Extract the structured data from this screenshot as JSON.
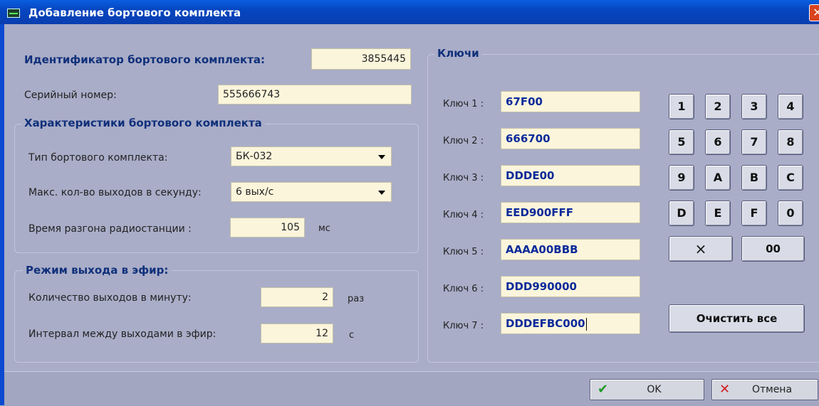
{
  "window": {
    "title": "Добавление бортового комплекта",
    "close_icon": "close-icon"
  },
  "left": {
    "identifier_label": "Идентификатор бортового комплекта:",
    "identifier_value": "3855445",
    "serial_label": "Серийный номер:",
    "serial_value": "555666743",
    "characteristics": {
      "title": "Характеристики бортового комплекта",
      "type_label": "Тип бортового комплекта:",
      "type_value": "БК-032",
      "max_label": "Макс. кол-во выходов в секунду:",
      "max_value": "6 вых/с",
      "accel_label": "Время разгона радиостанции :",
      "accel_value": "105",
      "accel_unit": "мс"
    },
    "broadcast": {
      "title": "Режим выхода в эфир:",
      "count_label": "Количество выходов в минуту:",
      "count_value": "2",
      "count_unit": "раз",
      "interval_label": "Интервал между выходами в эфир:",
      "interval_value": "12",
      "interval_unit": "с"
    }
  },
  "keys": {
    "title": "Ключи",
    "items": [
      {
        "label": "Ключ 1 :",
        "value": "67F00"
      },
      {
        "label": "Ключ 2 :",
        "value": "666700"
      },
      {
        "label": "Ключ 3 :",
        "value": "DDDE00"
      },
      {
        "label": "Ключ 4 :",
        "value": "EED900FFF"
      },
      {
        "label": "Ключ 5 :",
        "value": "AAAA00BBB"
      },
      {
        "label": "Ключ 6 :",
        "value": "DDD990000"
      },
      {
        "label": "Ключ 7 :",
        "value": "DDDEFBC000"
      }
    ],
    "keypad": [
      "1",
      "2",
      "3",
      "4",
      "5",
      "6",
      "7",
      "8",
      "9",
      "A",
      "B",
      "C",
      "D",
      "E",
      "F",
      "0"
    ],
    "backspace": "×",
    "double_zero": "00",
    "clear_all": "Очистить все"
  },
  "footer": {
    "ok": "OK",
    "cancel": "Отмена",
    "ok_icon": "checkmark-icon",
    "cancel_icon": "x-icon"
  }
}
